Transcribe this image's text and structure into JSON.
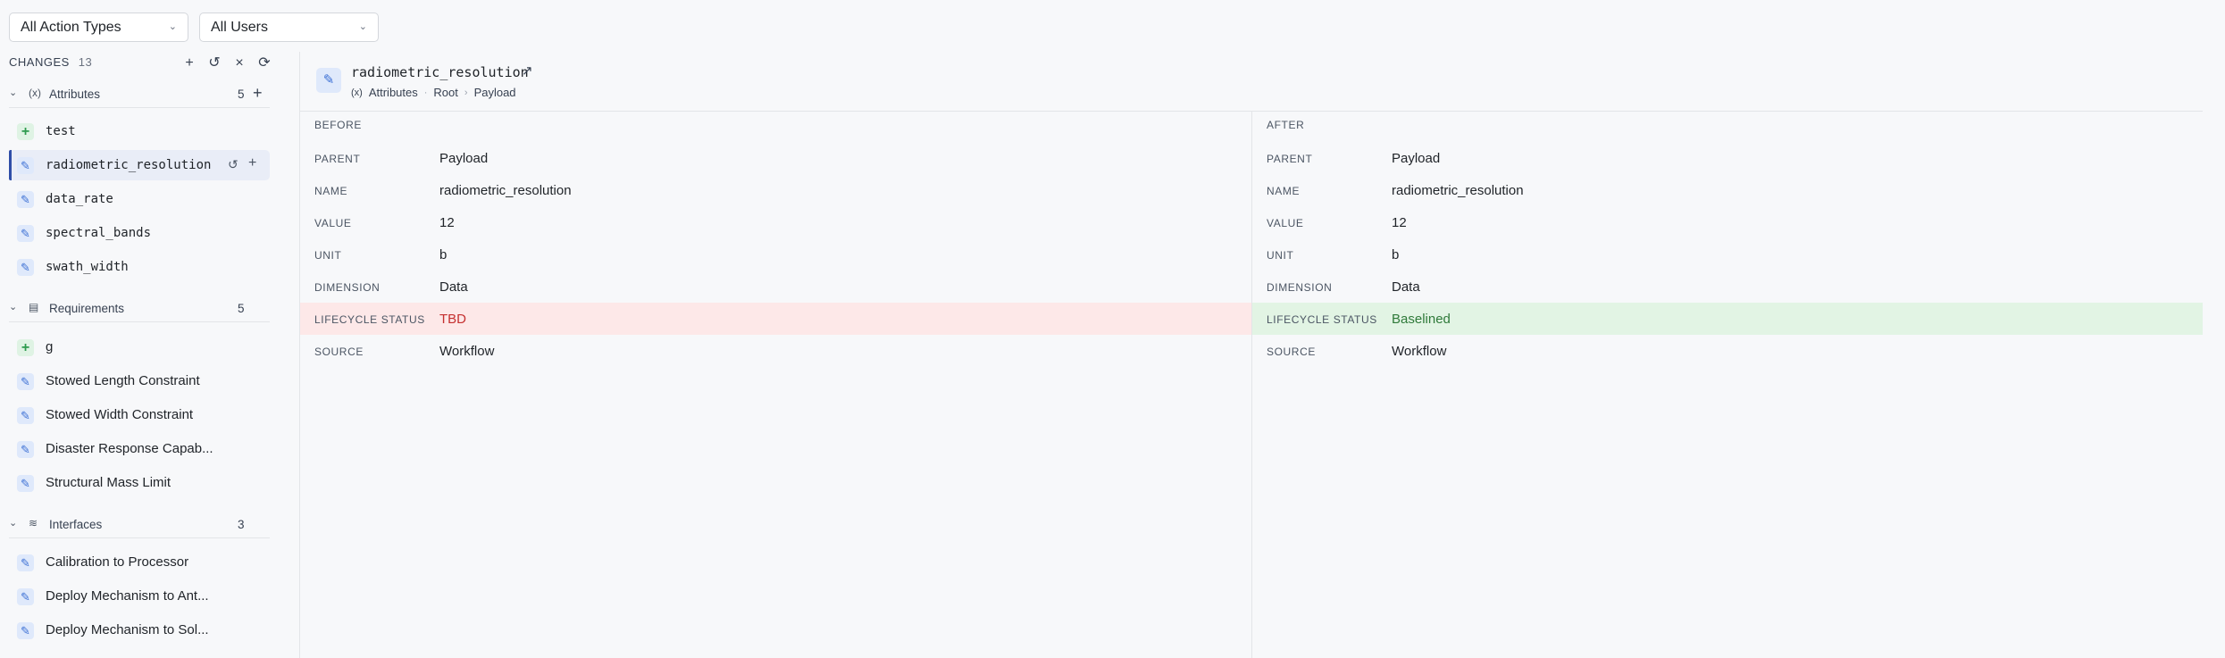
{
  "filters": {
    "action_type": "All Action Types",
    "users": "All Users"
  },
  "sidebar": {
    "title": "CHANGES",
    "count": "13",
    "groups": [
      {
        "label": "Attributes",
        "count": "5",
        "items": [
          {
            "label": "test",
            "kind": "add"
          },
          {
            "label": "radiometric_resolution",
            "kind": "modify"
          },
          {
            "label": "data_rate",
            "kind": "modify"
          },
          {
            "label": "spectral_bands",
            "kind": "modify"
          },
          {
            "label": "swath_width",
            "kind": "modify"
          }
        ]
      },
      {
        "label": "Requirements",
        "count": "5",
        "items": [
          {
            "label": "g",
            "kind": "add"
          },
          {
            "label": "Stowed Length Constraint",
            "kind": "modify"
          },
          {
            "label": "Stowed Width Constraint",
            "kind": "modify"
          },
          {
            "label": "Disaster Response Capab...",
            "kind": "modify"
          },
          {
            "label": "Structural Mass Limit",
            "kind": "modify"
          }
        ]
      },
      {
        "label": "Interfaces",
        "count": "3",
        "items": [
          {
            "label": "Calibration to Processor",
            "kind": "modify"
          },
          {
            "label": "Deploy Mechanism to Ant...",
            "kind": "modify"
          },
          {
            "label": "Deploy Mechanism to Sol...",
            "kind": "modify"
          }
        ]
      }
    ]
  },
  "detail": {
    "title": "radiometric_resolution",
    "breadcrumb": [
      "Attributes",
      "Root",
      "Payload"
    ],
    "before": {
      "title": "BEFORE",
      "rows": [
        {
          "label": "PARENT",
          "value": "Payload"
        },
        {
          "label": "NAME",
          "value": "radiometric_resolution"
        },
        {
          "label": "VALUE",
          "value": "12"
        },
        {
          "label": "UNIT",
          "value": "b"
        },
        {
          "label": "DIMENSION",
          "value": "Data"
        },
        {
          "label": "LIFECYCLE STATUS",
          "value": "TBD"
        },
        {
          "label": "SOURCE",
          "value": "Workflow"
        }
      ]
    },
    "after": {
      "title": "AFTER",
      "rows": [
        {
          "label": "PARENT",
          "value": "Payload"
        },
        {
          "label": "NAME",
          "value": "radiometric_resolution"
        },
        {
          "label": "VALUE",
          "value": "12"
        },
        {
          "label": "UNIT",
          "value": "b"
        },
        {
          "label": "DIMENSION",
          "value": "Data"
        },
        {
          "label": "LIFECYCLE STATUS",
          "value": "Baselined"
        },
        {
          "label": "SOURCE",
          "value": "Workflow"
        }
      ]
    }
  },
  "colors": {
    "removed_bg": "#fde8e8",
    "removed_text": "#c53030",
    "added_bg": "#e2f4e4",
    "added_text": "#2f7a3a",
    "selected_accent": "#2f4ea8"
  },
  "icons": {
    "add": "plus-icon",
    "modify": "pencil-icon"
  }
}
